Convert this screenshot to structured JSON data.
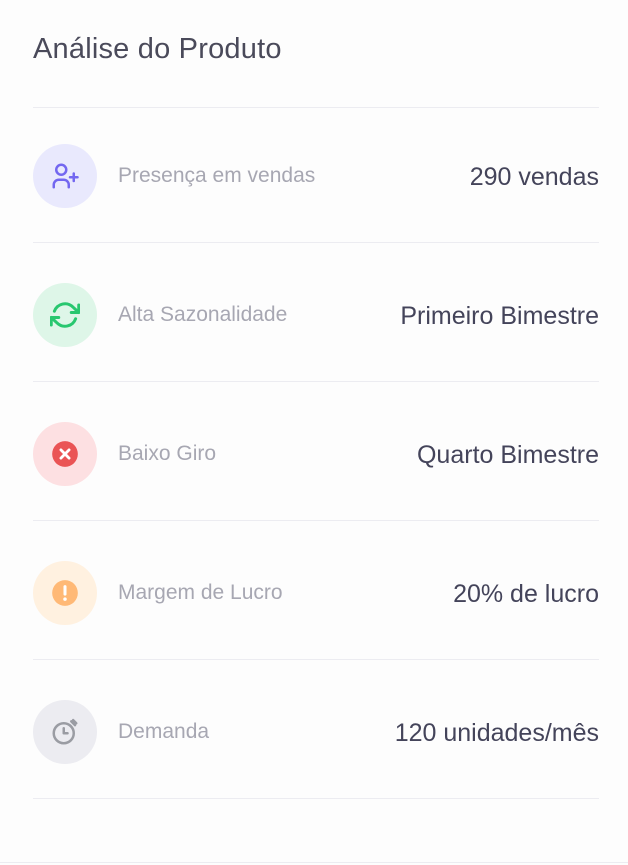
{
  "header": {
    "title": "Análise do Produto"
  },
  "colors": {
    "sales_bg": "#e9e9fd",
    "sales_fg": "#7367f0",
    "season_bg": "#def6e8",
    "season_fg": "#28c76f",
    "low_bg": "#fde0e2",
    "low_fg": "#ea5455",
    "margin_bg": "#fff1e0",
    "margin_fg": "#ff9f43",
    "demand_bg": "#ececf1",
    "demand_fg": "#82868b"
  },
  "rows": [
    {
      "icon": "user-plus-icon",
      "label": "Presença em vendas",
      "value": "290 vendas"
    },
    {
      "icon": "refresh-icon",
      "label": "Alta Sazonalidade",
      "value": "Primeiro Bimestre"
    },
    {
      "icon": "x-circle-icon",
      "label": "Baixo Giro",
      "value": "Quarto Bimestre"
    },
    {
      "icon": "alert-circle-icon",
      "label": "Margem de Lucro",
      "value": "20% de lucro"
    },
    {
      "icon": "timer-icon",
      "label": "Demanda",
      "value": "120 unidades/mês"
    }
  ]
}
